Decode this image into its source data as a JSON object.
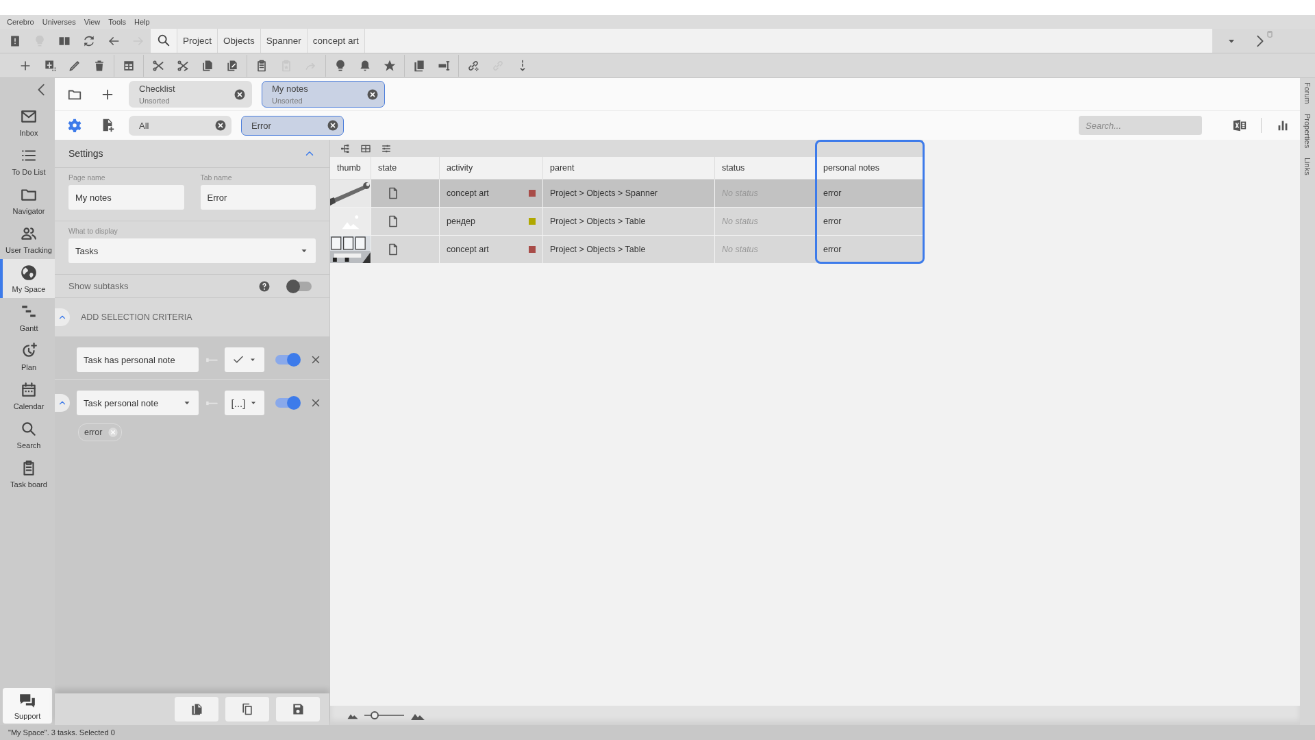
{
  "menu": [
    "Cerebro",
    "Universes",
    "View",
    "Tools",
    "Help"
  ],
  "nav_toolbar": {
    "buttons": [
      {
        "kind": "book",
        "disabled": false
      },
      {
        "kind": "bulb",
        "disabled": true
      },
      {
        "kind": "panels",
        "disabled": false
      },
      {
        "kind": "refresh",
        "disabled": false
      },
      {
        "kind": "back",
        "disabled": false
      },
      {
        "kind": "forward",
        "disabled": true
      }
    ],
    "breadcrumb": [
      "Project",
      "Objects",
      "Spanner",
      "concept art"
    ]
  },
  "action_toolbar": [
    [
      {
        "kind": "plus",
        "disabled": false
      },
      {
        "kind": "add-box",
        "disabled": false
      },
      {
        "kind": "pencil",
        "disabled": false
      },
      {
        "kind": "trash",
        "disabled": false
      }
    ],
    [
      {
        "kind": "table-stack",
        "disabled": false
      }
    ],
    [
      {
        "kind": "scissors",
        "disabled": false
      },
      {
        "kind": "scissors-arrow",
        "disabled": false
      },
      {
        "kind": "copy",
        "disabled": false
      },
      {
        "kind": "copy-link",
        "disabled": false
      }
    ],
    [
      {
        "kind": "clipboard",
        "disabled": false
      },
      {
        "kind": "clipboard-star",
        "disabled": true
      },
      {
        "kind": "redo",
        "disabled": true
      }
    ],
    [
      {
        "kind": "bulb",
        "disabled": false
      },
      {
        "kind": "bell",
        "disabled": false
      },
      {
        "kind": "star",
        "disabled": false
      }
    ],
    [
      {
        "kind": "documents",
        "disabled": false
      },
      {
        "kind": "textbox",
        "disabled": false
      }
    ],
    [
      {
        "kind": "link-add",
        "disabled": false
      },
      {
        "kind": "link",
        "disabled": true
      },
      {
        "kind": "dots",
        "disabled": false
      }
    ]
  ],
  "sidebar": {
    "items": [
      {
        "label": "Inbox",
        "kind": "mail",
        "selected": false
      },
      {
        "label": "To Do List",
        "kind": "list",
        "selected": false
      },
      {
        "label": "Navigator",
        "kind": "folder",
        "selected": false
      },
      {
        "label": "User Tracking",
        "kind": "users",
        "selected": false
      },
      {
        "label": "My Space",
        "kind": "globe",
        "selected": true
      },
      {
        "label": "Gantt",
        "kind": "gantt",
        "selected": false
      },
      {
        "label": "Plan",
        "kind": "clock-plus",
        "selected": false
      },
      {
        "label": "Calendar",
        "kind": "calendar",
        "selected": false
      },
      {
        "label": "Search",
        "kind": "search",
        "selected": false
      },
      {
        "label": "Task board",
        "kind": "clipboard",
        "selected": false
      }
    ],
    "support": "Support"
  },
  "page_tabs": [
    {
      "title": "Checklist",
      "subtitle": "Unsorted",
      "selected": false
    },
    {
      "title": "My notes",
      "subtitle": "Unsorted",
      "selected": true
    }
  ],
  "filter_tabs": [
    {
      "label": "All",
      "selected": false
    },
    {
      "label": "Error",
      "selected": true
    }
  ],
  "search": {
    "placeholder": "Search..."
  },
  "settings": {
    "title": "Settings",
    "expanded": true,
    "page_name": {
      "label": "Page name",
      "value": "My notes"
    },
    "tab_name": {
      "label": "Tab name",
      "value": "Error"
    },
    "display": {
      "label": "What to display",
      "value": "Tasks"
    },
    "show_subtasks": {
      "label": "Show subtasks",
      "on": false
    },
    "criteria_title": "ADD SELECTION CRITERIA",
    "criteria_expanded": true,
    "criteria": [
      {
        "kind": "flag",
        "field": "Task has personal note",
        "on": true
      },
      {
        "kind": "list",
        "field": "Task personal note",
        "operator": "[...]",
        "on": true,
        "expanded": true,
        "values": [
          "error"
        ]
      }
    ]
  },
  "table": {
    "columns": [
      {
        "label": "thumb",
        "highlighted": false
      },
      {
        "label": "state",
        "highlighted": false
      },
      {
        "label": "activity",
        "highlighted": false
      },
      {
        "label": "parent",
        "highlighted": false
      },
      {
        "label": "status",
        "highlighted": false
      },
      {
        "label": "personal notes",
        "highlighted": true
      }
    ],
    "rows": [
      {
        "kind": "picture",
        "activity": "concept art",
        "color": "#a84c48",
        "parent": "Project > Objects > Spanner",
        "status": "No status",
        "note": "error",
        "selected": true
      },
      {
        "kind": "placeholder",
        "activity": "рендер",
        "color": "#b0a800",
        "parent": "Project > Objects > Table",
        "status": "No status",
        "note": "error",
        "selected": false
      },
      {
        "kind": "picture",
        "activity": "concept art",
        "color": "#a84c48",
        "parent": "Project > Objects > Table",
        "status": "No status",
        "note": "error",
        "selected": false
      }
    ]
  },
  "zoom": {
    "level": 0.2
  },
  "right_tabs": [
    "Forum",
    "Properties",
    "Links"
  ],
  "status_bar": "\"My Space\". 3 tasks. Selected 0"
}
